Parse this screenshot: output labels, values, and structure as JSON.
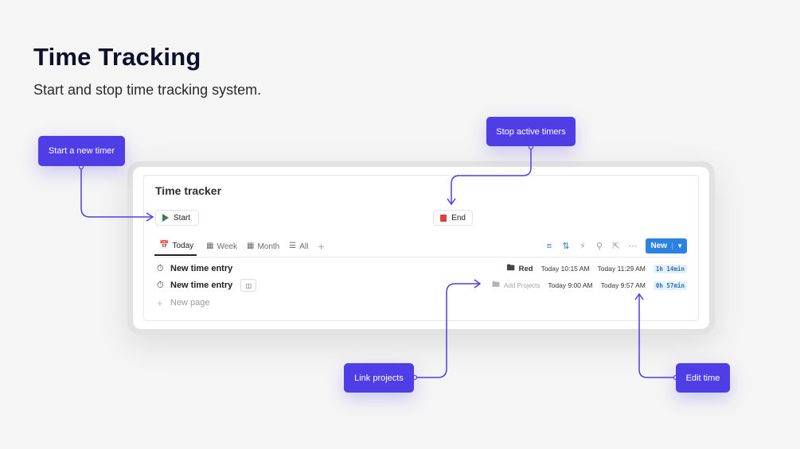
{
  "header": {
    "title": "Time Tracking",
    "subtitle": "Start and stop time tracking system."
  },
  "tracker": {
    "title": "Time tracker",
    "start_label": "Start",
    "end_label": "End",
    "tabs": [
      {
        "label": "Today",
        "icon": "calendar-icon",
        "active": true
      },
      {
        "label": "Week",
        "icon": "calendar-grid-icon",
        "active": false
      },
      {
        "label": "Month",
        "icon": "calendar-grid-icon",
        "active": false
      },
      {
        "label": "All",
        "icon": "timeline-icon",
        "active": false
      }
    ],
    "toolbar": {
      "icons": [
        "filter-icon",
        "sort-icon",
        "automation-icon",
        "search-icon",
        "expand-icon",
        "more-icon"
      ],
      "new_label": "New"
    },
    "entries": [
      {
        "title": "New time entry",
        "project": "Red",
        "start": "Today 10:15 AM",
        "end": "Today 11:29 AM",
        "duration": "1h 14min"
      },
      {
        "title": "New time entry",
        "project": "Add Projects",
        "start": "Today 9:00 AM",
        "end": "Today 9:57 AM",
        "duration": "0h 57min"
      }
    ],
    "new_page_label": "New page"
  },
  "callouts": {
    "start": "Start a new timer",
    "stop": "Stop active timers",
    "link": "Link projects",
    "edit": "Edit time"
  },
  "colors": {
    "accent": "#4f3ee6",
    "new_button": "#2c82e0",
    "start_icon": "#3a7d4f",
    "end_icon": "#d9413c",
    "duration_text": "#2d73b6"
  }
}
